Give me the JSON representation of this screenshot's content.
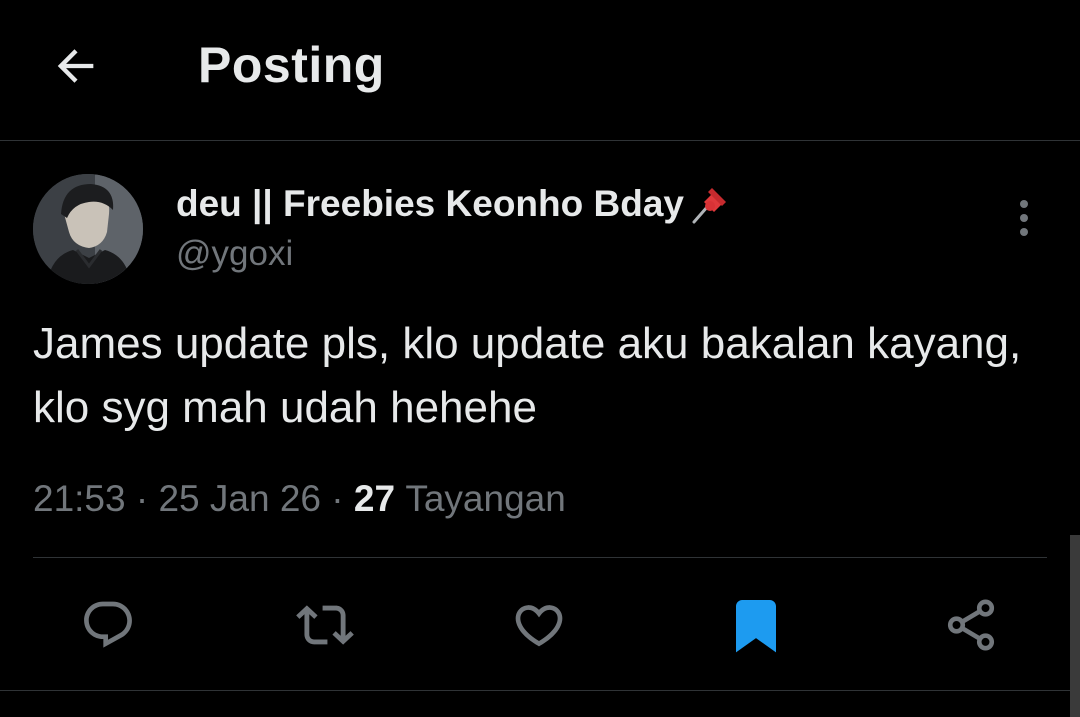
{
  "header": {
    "back_icon": "arrow-left-icon",
    "title": "Posting"
  },
  "post": {
    "author": {
      "display_name": "deu || Freebies Keonho Bday",
      "name_emoji_icon": "pushpin-icon",
      "handle": "@ygoxi"
    },
    "more_icon": "more-vertical-icon",
    "text": "James update pls, klo update aku bakalan kayang, klo syg mah udah hehehe",
    "time": "21:53",
    "separator": "·",
    "date": "25 Jan 26",
    "views_count": "27",
    "views_label": "Tayangan"
  },
  "actions": [
    {
      "name": "reply",
      "icon": "reply-icon"
    },
    {
      "name": "repost",
      "icon": "repost-icon"
    },
    {
      "name": "like",
      "icon": "heart-icon"
    },
    {
      "name": "bookmark",
      "icon": "bookmark-icon",
      "active": true
    },
    {
      "name": "share",
      "icon": "share-icon"
    }
  ],
  "colors": {
    "background": "#000000",
    "text_primary": "#e7e9ea",
    "text_secondary": "#71767b",
    "divider": "#2f3336",
    "bookmark_active": "#1d9bf0"
  }
}
